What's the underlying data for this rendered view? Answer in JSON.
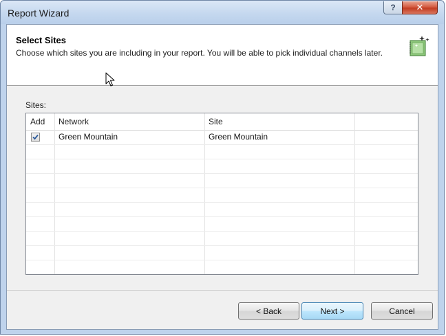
{
  "window": {
    "title": "Report Wizard",
    "help_label": "?",
    "close_label": "✕"
  },
  "header": {
    "title": "Select Sites",
    "description": "Choose which sites you are including in your report. You will be able to pick individual channels later.",
    "icon": "wizard-sparkle-icon"
  },
  "sites": {
    "label": "Sites:",
    "columns": [
      "Add",
      "Network",
      "Site",
      ""
    ],
    "rows": [
      {
        "add": true,
        "network": "Green Mountain",
        "site": "Green Mountain"
      }
    ]
  },
  "buttons": {
    "back": "< Back",
    "next": "Next >",
    "cancel": "Cancel"
  },
  "colors": {
    "titlebar": "#c5d8ef",
    "close": "#c94a31",
    "default_button": "#bee6fd"
  }
}
